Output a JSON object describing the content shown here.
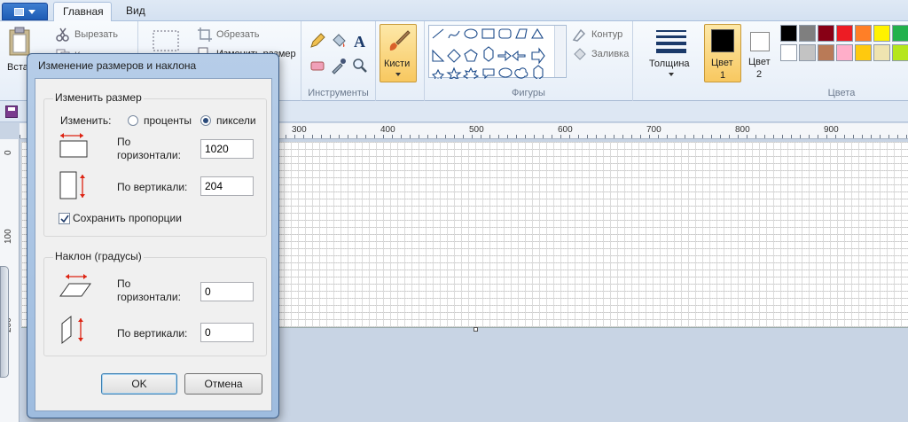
{
  "tabs": {
    "home": "Главная",
    "view": "Вид"
  },
  "ribbon": {
    "clipboard": {
      "paste_label": "Вста",
      "cut_label": "Вырезать",
      "copy_label": "Копировать"
    },
    "image": {
      "crop_label": "Обрезать",
      "resize_label": "Изменить размер"
    },
    "tools_label": "Инструменты",
    "brushes_label": "Кисти",
    "shapes_label": "Фигуры",
    "outline_label": "Контур",
    "fill_label": "Заливка",
    "thickness_label": "Толщина",
    "color1_label_line1": "Цвет",
    "color1_label_line2": "1",
    "color2_label_line1": "Цвет",
    "color2_label_line2": "2",
    "colors_label": "Цвета",
    "palette_row1": [
      "#000000",
      "#7f7f7f",
      "#880015",
      "#ed1c24",
      "#ff7f27",
      "#fff200",
      "#22b14c"
    ],
    "palette_row2": [
      "#ffffff",
      "#c3c3c3",
      "#b97a57",
      "#ffaec9",
      "#ffc90e",
      "#efe4b0",
      "#b5e61d"
    ]
  },
  "ruler": {
    "top_ticks": [
      "300",
      "400",
      "500",
      "600",
      "700",
      "800",
      "900"
    ],
    "left_ticks": [
      "0",
      "100",
      "200"
    ]
  },
  "dialog": {
    "title": "Изменение размеров и наклона",
    "resize_group": "Изменить размер",
    "change_by": "Изменить:",
    "percent": "проценты",
    "pixels": "пиксели",
    "horizontal_line1": "По",
    "horizontal_line2": "горизонтали:",
    "vertical": "По вертикали:",
    "resize_h": "1020",
    "resize_v": "204",
    "keep_ratio": "Сохранить пропорции",
    "skew_group": "Наклон (градусы)",
    "skew_h": "0",
    "skew_v": "0",
    "ok": "OK",
    "cancel": "Отмена"
  }
}
